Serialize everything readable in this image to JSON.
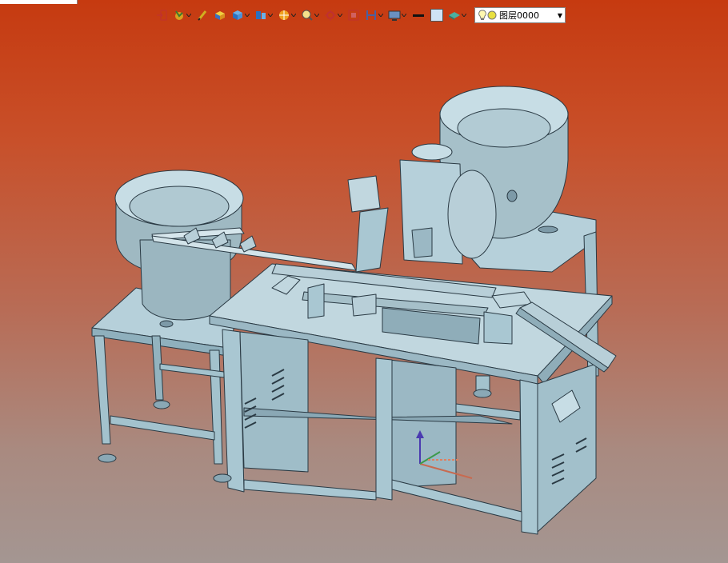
{
  "toolbar": {
    "buttons": [
      {
        "name": "exit-sketch-icon"
      },
      {
        "name": "point-tool-icon"
      },
      {
        "name": "pen-tool-icon"
      },
      {
        "name": "box-solid-icon"
      },
      {
        "name": "cube-view-icon"
      },
      {
        "name": "cube-split-icon"
      },
      {
        "name": "render-style-icon"
      },
      {
        "name": "zoom-icon"
      },
      {
        "name": "pan-icon"
      },
      {
        "name": "fit-view-icon"
      },
      {
        "name": "section-icon"
      },
      {
        "name": "display-icon"
      }
    ],
    "line_color": "#111111",
    "fill_color": "#cfe3f5",
    "layer": {
      "label": "图层0000"
    }
  },
  "colors": {
    "background_top": "#c63a10",
    "background_bottom": "#a49692",
    "model": "#a9c7d2"
  }
}
